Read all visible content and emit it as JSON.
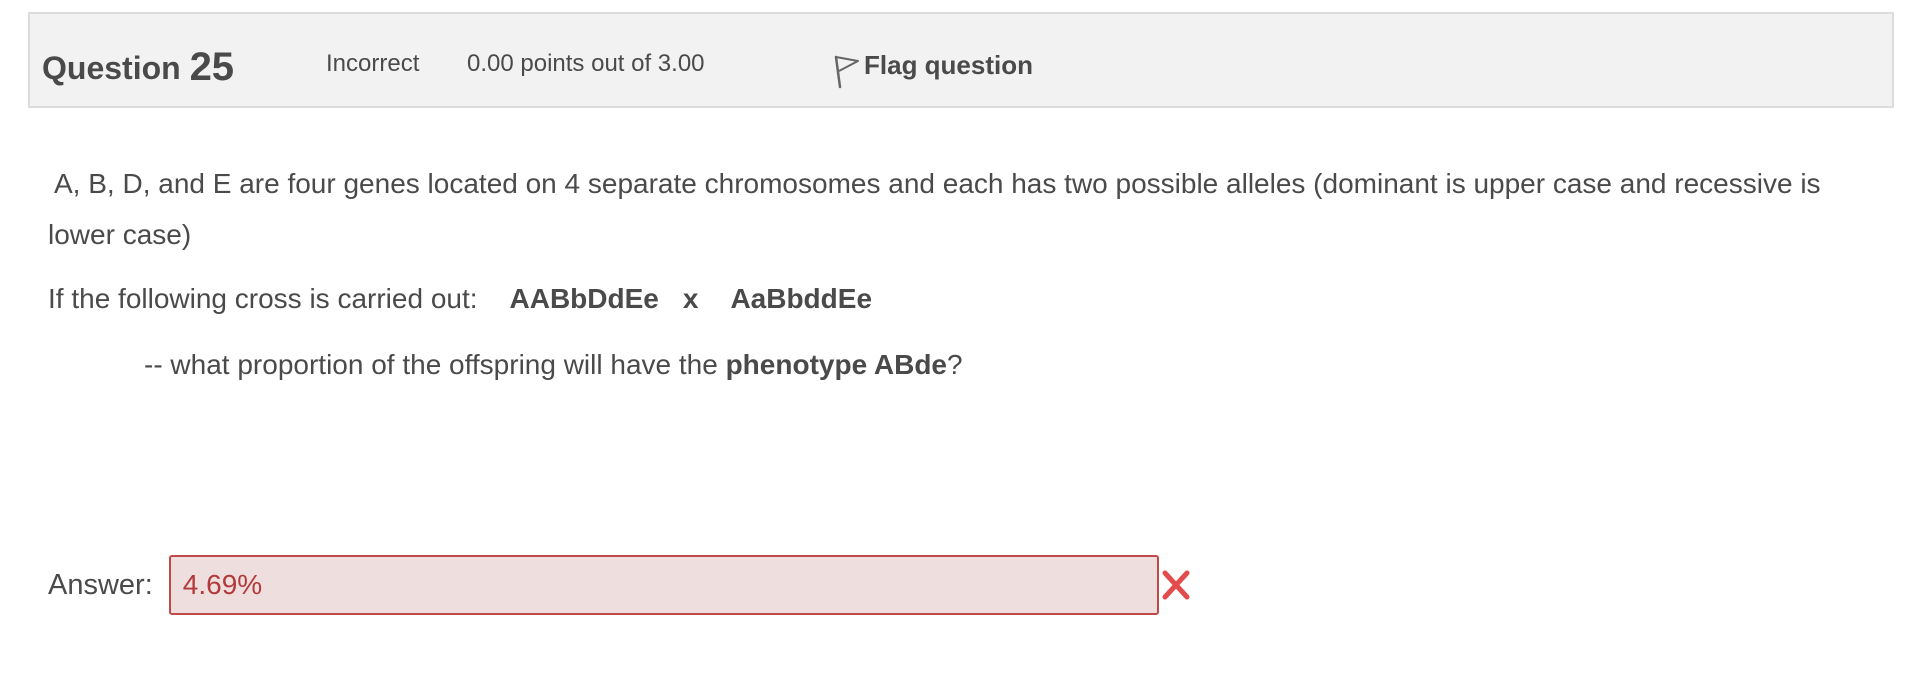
{
  "question": {
    "title_prefix": "Question",
    "number": "25",
    "state": "Incorrect",
    "grade": "0.00 points out of 3.00",
    "flag_label": "Flag question"
  },
  "text": {
    "para1": "A, B, D, and E are four genes located on 4 separate chromosomes and each has two possible alleles (dominant  is upper case and recessive is lower case)",
    "para2_prefix": "If the following cross is carried out:",
    "cross_parent1": "AABbDdEe",
    "cross_symbol": "x",
    "cross_parent2": "AaBbddEe",
    "para3_prefix": "-- what proportion of the offspring will have the ",
    "para3_bold": "phenotype ABde",
    "para3_suffix": "?"
  },
  "answer": {
    "label": "Answer:",
    "value": "4.69%",
    "status": "incorrect"
  },
  "colors": {
    "info_bg": "#f2f2f2",
    "text": "#4a4a4a",
    "incorrect_bg": "#efdede",
    "incorrect_border": "#c04949",
    "incorrect_icon": "#e24c4c"
  },
  "icons": {
    "flag": "flag-icon",
    "result": "incorrect-x-icon"
  }
}
